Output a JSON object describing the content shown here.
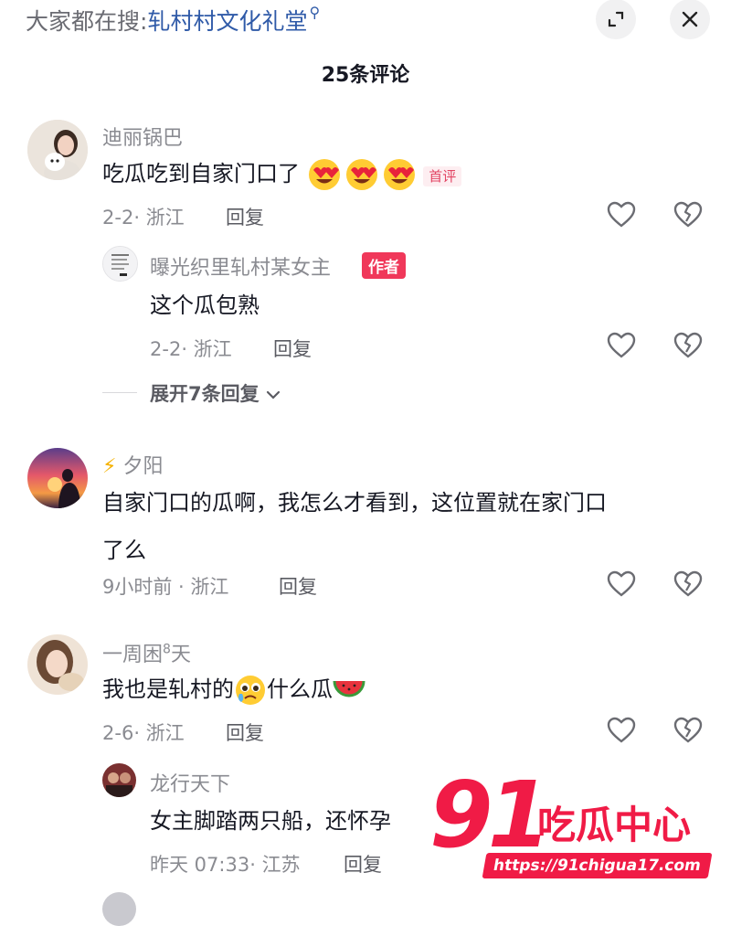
{
  "search": {
    "prefix": "大家都在搜:",
    "term": "轧村村文化礼堂"
  },
  "header": {
    "title": "25条评论"
  },
  "comments": [
    {
      "user": "迪丽锅巴",
      "text": "吃瓜吃到自家门口了",
      "badge": "首评",
      "date": "2-2",
      "location": "浙江",
      "reply_label": "回复",
      "replies": [
        {
          "user": "曝光织里轧村某女主",
          "author_badge": "作者",
          "text": "这个瓜包熟",
          "date": "2-2",
          "location": "浙江",
          "reply_label": "回复"
        }
      ],
      "expand_label": "展开7条回复"
    },
    {
      "user": "夕阳",
      "user_prefix_icon": "lightning-emoji",
      "text_line1": "自家门口的瓜啊，我怎么才看到，这位置就在家门口",
      "text_line2": "了么",
      "date": "9小时前",
      "location": "浙江",
      "reply_label": "回复"
    },
    {
      "user": "一周困",
      "user_suffix": "8",
      "user_end": "天",
      "text_a": "我也是轧村的",
      "text_b": "什么瓜",
      "date": "2-6",
      "location": "浙江",
      "reply_label": "回复",
      "replies": [
        {
          "user": "龙行天下",
          "text": "女主脚踏两只船，还怀孕",
          "date": "昨天 07:33",
          "location": "江苏",
          "reply_label": "回复"
        }
      ]
    }
  ],
  "watermark": {
    "number": "91",
    "brand": "吃瓜中心",
    "url": "https://91chigua17.com"
  },
  "colors": {
    "link": "#2f5aa8",
    "badge_red": "#f0385a",
    "gray_text": "#8a8b91",
    "watermark_red": "#f01b46"
  }
}
